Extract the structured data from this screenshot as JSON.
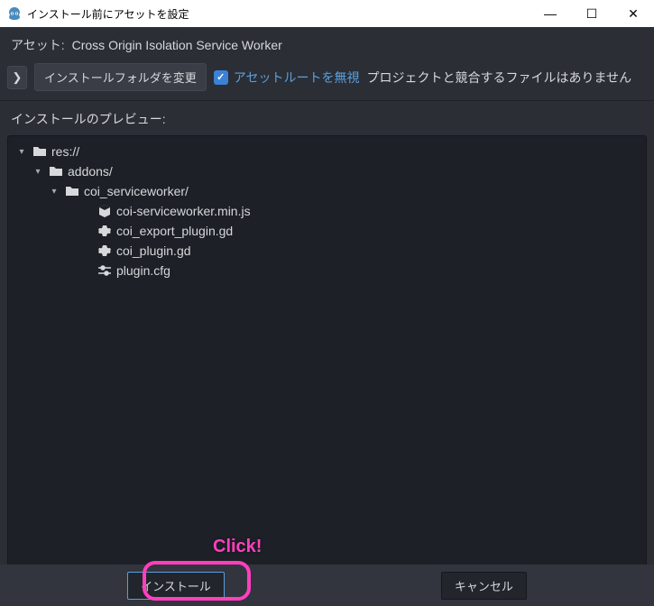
{
  "window": {
    "title": "インストール前にアセットを設定"
  },
  "asset": {
    "label": "アセット:",
    "name": "Cross Origin Isolation Service Worker"
  },
  "toolbar": {
    "expand_glyph": "❯",
    "change_folder": "インストールフォルダを変更",
    "ignore_root": "アセットルートを無視",
    "no_conflicts": "プロジェクトと競合するファイルはありません",
    "checkmark": "✓"
  },
  "preview": {
    "label": "インストールのプレビュー:"
  },
  "tree": {
    "nodes": [
      {
        "indent": 0,
        "chev": "▾",
        "icon": "folder",
        "label": "res://"
      },
      {
        "indent": 1,
        "chev": "▾",
        "icon": "folder",
        "label": "addons/"
      },
      {
        "indent": 2,
        "chev": "▾",
        "icon": "folder",
        "label": "coi_serviceworker/"
      },
      {
        "indent": 3,
        "chev": "",
        "icon": "cube",
        "label": "coi-serviceworker.min.js"
      },
      {
        "indent": 3,
        "chev": "",
        "icon": "gear",
        "label": "coi_export_plugin.gd"
      },
      {
        "indent": 3,
        "chev": "",
        "icon": "gear",
        "label": "coi_plugin.gd"
      },
      {
        "indent": 3,
        "chev": "",
        "icon": "cfg",
        "label": "plugin.cfg"
      }
    ]
  },
  "footer": {
    "install": "インストール",
    "cancel": "キャンセル"
  },
  "annotation": {
    "click": "Click!"
  }
}
